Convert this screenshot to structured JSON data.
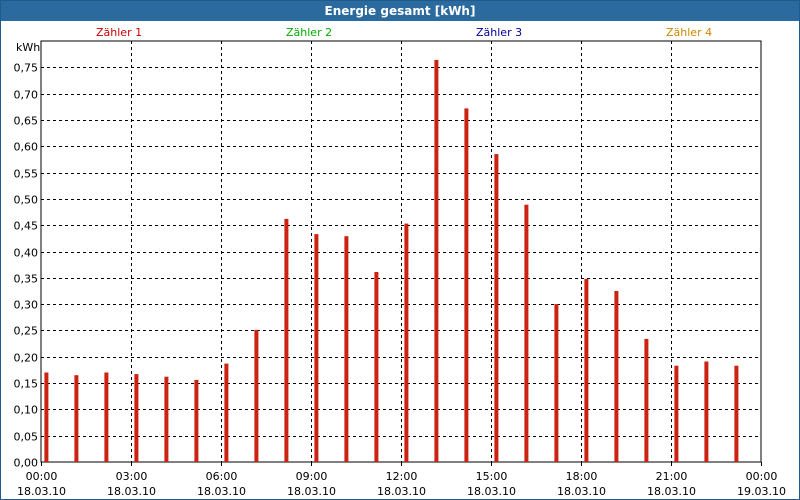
{
  "window": {
    "title": "Energie gesamt [kWh]"
  },
  "legend": [
    {
      "name": "Zähler 1",
      "color": "#cc0000"
    },
    {
      "name": "Zähler 2",
      "color": "#00aa00"
    },
    {
      "name": "Zähler 3",
      "color": "#000099"
    },
    {
      "name": "Zähler 4",
      "color": "#cc8800"
    }
  ],
  "chart_data": {
    "type": "bar",
    "title": "Energie gesamt [kWh]",
    "ylabel": "kWh",
    "ylim": [
      0,
      0.8
    ],
    "yticks": [
      "0,00",
      "0,05",
      "0,10",
      "0,15",
      "0,20",
      "0,25",
      "0,30",
      "0,35",
      "0,40",
      "0,45",
      "0,50",
      "0,55",
      "0,60",
      "0,65",
      "0,70",
      "0,75"
    ],
    "xlim": [
      "2010-03-18 00:00",
      "2010-03-19 00:00"
    ],
    "xticks": [
      {
        "time": "00:00",
        "date": "18.03.10"
      },
      {
        "time": "03:00",
        "date": "18.03.10"
      },
      {
        "time": "06:00",
        "date": "18.03.10"
      },
      {
        "time": "09:00",
        "date": "18.03.10"
      },
      {
        "time": "12:00",
        "date": "18.03.10"
      },
      {
        "time": "15:00",
        "date": "18.03.10"
      },
      {
        "time": "18:00",
        "date": "18.03.10"
      },
      {
        "time": "21:00",
        "date": "18.03.10"
      },
      {
        "time": "00:00",
        "date": "19.03.10"
      }
    ],
    "grid": true,
    "legend_position": "top",
    "series": [
      {
        "name": "Zähler 1",
        "color": "#cc2211",
        "x": [
          "00:00",
          "01:00",
          "02:00",
          "03:00",
          "04:00",
          "05:00",
          "06:00",
          "07:00",
          "08:00",
          "09:00",
          "10:00",
          "11:00",
          "12:00",
          "13:00",
          "14:00",
          "15:00",
          "16:00",
          "17:00",
          "18:00",
          "19:00",
          "20:00",
          "21:00",
          "22:00",
          "23:00"
        ],
        "values": [
          0.17,
          0.165,
          0.17,
          0.167,
          0.162,
          0.156,
          0.187,
          0.251,
          0.462,
          0.433,
          0.429,
          0.361,
          0.453,
          0.764,
          0.672,
          0.585,
          0.489,
          0.3,
          0.348,
          0.325,
          0.234,
          0.183,
          0.191,
          0.183
        ]
      }
    ]
  }
}
